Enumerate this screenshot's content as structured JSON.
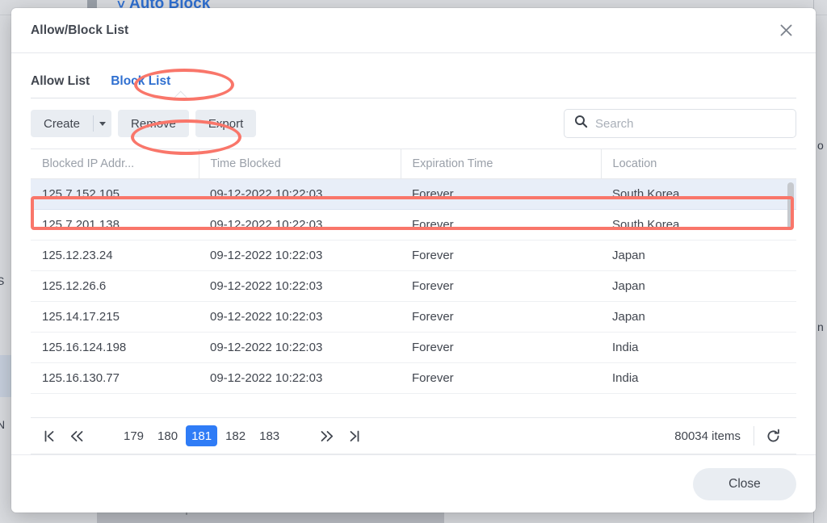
{
  "background": {
    "auto_block_label": "Auto Block",
    "chevron_icon": "chevron-up-icon",
    "left_fragment_1": "S",
    "left_fragment_2": "N",
    "right_fragment_1": "o",
    "right_fragment_2": "n"
  },
  "dialog": {
    "title": "Allow/Block List",
    "close_icon": "close-icon"
  },
  "tabs": [
    {
      "label": "Allow List",
      "active": false
    },
    {
      "label": "Block List",
      "active": true
    }
  ],
  "toolbar": {
    "create_label": "Create",
    "create_caret_icon": "chevron-down-icon",
    "remove_label": "Remove",
    "export_label": "Export",
    "search_icon": "search-icon",
    "search_placeholder": "Search",
    "search_value": ""
  },
  "table": {
    "columns": [
      "Blocked IP Addr...",
      "Time Blocked",
      "Expiration Time",
      "Location"
    ],
    "rows": [
      {
        "ip": "125.7.152.105",
        "time": "09-12-2022 10:22:03",
        "expiration": "Forever",
        "location": "South Korea",
        "selected": true
      },
      {
        "ip": "125.7.201.138",
        "time": "09-12-2022 10:22:03",
        "expiration": "Forever",
        "location": "South Korea",
        "selected": false
      },
      {
        "ip": "125.12.23.24",
        "time": "09-12-2022 10:22:03",
        "expiration": "Forever",
        "location": "Japan",
        "selected": false
      },
      {
        "ip": "125.12.26.6",
        "time": "09-12-2022 10:22:03",
        "expiration": "Forever",
        "location": "Japan",
        "selected": false
      },
      {
        "ip": "125.14.17.215",
        "time": "09-12-2022 10:22:03",
        "expiration": "Forever",
        "location": "Japan",
        "selected": false
      },
      {
        "ip": "125.16.124.198",
        "time": "09-12-2022 10:22:03",
        "expiration": "Forever",
        "location": "India",
        "selected": false
      },
      {
        "ip": "125.16.130.77",
        "time": "09-12-2022 10:22:03",
        "expiration": "Forever",
        "location": "India",
        "selected": false
      }
    ]
  },
  "pagination": {
    "first_icon": "go-to-first-page-icon",
    "prev_icon": "previous-pages-icon",
    "pages": [
      "179",
      "180",
      "181",
      "182",
      "183"
    ],
    "current_page": "181",
    "next_icon": "next-pages-icon",
    "last_icon": "go-to-last-page-icon",
    "item_count": "80034 items",
    "refresh_icon": "refresh-icon"
  },
  "footer": {
    "close_label": "Close"
  },
  "colors": {
    "accent_blue": "#2f6fd0",
    "page_active_blue": "#2f7cf6",
    "annotation_red": "#f9766a",
    "row_selected_bg": "#e8eef8",
    "button_bg": "#e9edf2"
  }
}
